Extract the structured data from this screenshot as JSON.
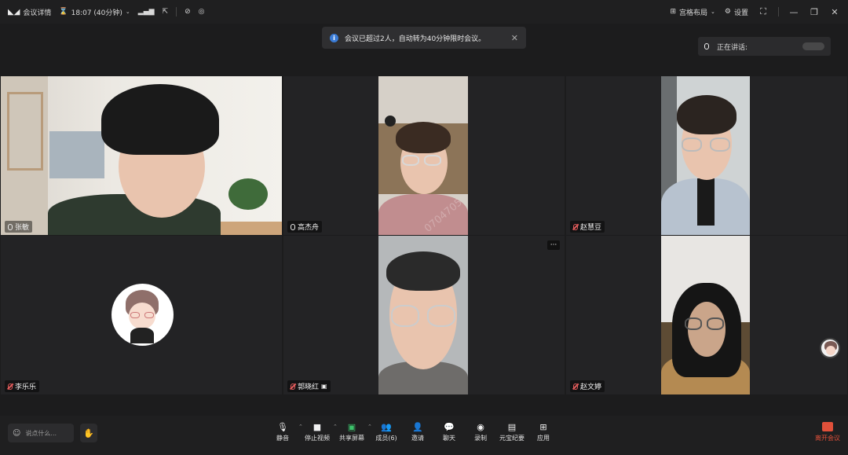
{
  "topbar": {
    "meeting_details": "会议详情",
    "time": "18:07 (40分钟)",
    "layout": "宫格布局",
    "settings": "设置"
  },
  "toast": {
    "message": "会议已超过2人，自动转为40分钟限时会议。"
  },
  "speaking": {
    "label": "正在讲话:"
  },
  "participants": [
    {
      "name": "张敏"
    },
    {
      "name": "高杰舟"
    },
    {
      "name": "赵慧豆"
    },
    {
      "name": "李乐乐"
    },
    {
      "name": "郭晓红"
    },
    {
      "name": "赵文婷"
    }
  ],
  "tile_more": "···",
  "watermark": "0704705",
  "chat": {
    "placeholder": "说点什么..."
  },
  "toolbar": [
    {
      "label": "静音",
      "icon": "mic-icon"
    },
    {
      "label": "停止视频",
      "icon": "video-camera-icon"
    },
    {
      "label": "共享屏幕",
      "icon": "share-screen-icon"
    },
    {
      "label": "成员(6)",
      "icon": "members-icon"
    },
    {
      "label": "邀请",
      "icon": "invite-icon"
    },
    {
      "label": "聊天",
      "icon": "chat-icon"
    },
    {
      "label": "录制",
      "icon": "record-icon"
    },
    {
      "label": "元宝纪要",
      "icon": "notes-icon"
    },
    {
      "label": "应用",
      "icon": "apps-icon"
    }
  ],
  "leave": {
    "label": "离开会议"
  },
  "colors": {
    "background": "#1c1c1d",
    "leave": "#e0503a",
    "info": "#3a7bd5"
  }
}
